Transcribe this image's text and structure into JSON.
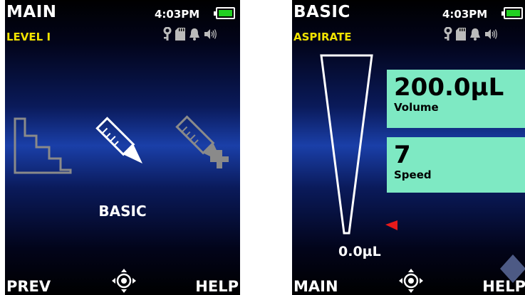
{
  "left_screen": {
    "title": "MAIN",
    "subtitle": "LEVEL I",
    "time": "4:03PM",
    "battery_color": "#21d021",
    "status_icons": [
      "key-icon",
      "sd-card-icon",
      "bell-icon",
      "speaker-icon"
    ],
    "modes": [
      "stepper-mode-icon",
      "basic-pipette-icon",
      "pipette-plus-icon"
    ],
    "selected_mode_label": "BASIC",
    "footer": {
      "left": "PREV",
      "right": "HELP",
      "center_icon": "navigation-joystick-icon"
    }
  },
  "right_screen": {
    "title": "BASIC",
    "subtitle": "ASPIRATE",
    "time": "4:03PM",
    "battery_color": "#21d021",
    "status_icons": [
      "key-icon",
      "sd-card-icon",
      "bell-icon",
      "speaker-icon"
    ],
    "tip_fill": 0,
    "current_volume": "0.0µL",
    "volume": {
      "value": "200.0µL",
      "label": "Volume"
    },
    "speed": {
      "value": "7",
      "label": "Speed"
    },
    "footer": {
      "left": "MAIN",
      "right": "HELP",
      "center_icon": "navigation-joystick-icon"
    }
  },
  "colors": {
    "accent_yellow": "#f2e300",
    "value_box": "#7ee9c3",
    "marker_red": "#e81a1a",
    "battery_green": "#21d021"
  }
}
